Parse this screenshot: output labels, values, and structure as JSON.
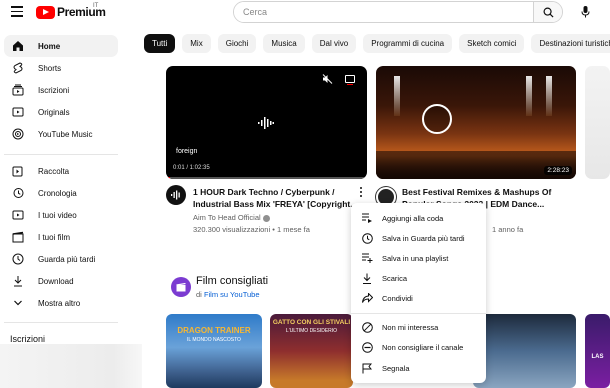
{
  "header": {
    "logo_text": "Premium",
    "country_code": "IT",
    "search_placeholder": "Cerca"
  },
  "sidebar": {
    "items": [
      {
        "label": "Home",
        "icon": "home-icon",
        "active": true
      },
      {
        "label": "Shorts",
        "icon": "shorts-icon"
      },
      {
        "label": "Iscrizioni",
        "icon": "subscriptions-icon"
      },
      {
        "label": "Originals",
        "icon": "originals-icon"
      },
      {
        "label": "YouTube Music",
        "icon": "music-icon"
      }
    ],
    "items2": [
      {
        "label": "Raccolta",
        "icon": "library-icon"
      },
      {
        "label": "Cronologia",
        "icon": "history-icon"
      },
      {
        "label": "I tuoi video",
        "icon": "your-videos-icon"
      },
      {
        "label": "I tuoi film",
        "icon": "your-movies-icon"
      },
      {
        "label": "Guarda più tardi",
        "icon": "watch-later-icon"
      },
      {
        "label": "Download",
        "icon": "download-icon"
      },
      {
        "label": "Mostra altro",
        "icon": "chevron-down-icon"
      }
    ],
    "subscriptions_title": "Iscrizioni"
  },
  "chips": [
    "Tutti",
    "Mix",
    "Giochi",
    "Musica",
    "Dal vivo",
    "Programmi di cucina",
    "Sketch comici",
    "Destinazioni turistiche"
  ],
  "videos": [
    {
      "title": "1 HOUR Dark Techno / Cyberpunk / Industrial Bass Mix 'FREYA' [Copyright...",
      "title_line1": "1 HOUR Dark Techno / Cyberpunk /",
      "title_line2": "Industrial Bass Mix 'FREYA' [Copyright...",
      "channel": "Aim To Head Official",
      "views": "320.300 visualizzazioni",
      "age": "1 mese fa",
      "overlay_label": "foreign",
      "time": "0:01 / 1:02:35",
      "progress": 0.02
    },
    {
      "title_line1": "Best Festival Remixes & Mashups Of",
      "title_line2": "Popular Songs 2023 | EDM Dance...",
      "age": "1 anno fa",
      "duration": "2:28:23"
    }
  ],
  "section": {
    "title": "Film consigliati",
    "sub_prefix": "di",
    "sub_link": "Film su YouTube"
  },
  "posters": [
    {
      "title": "DRAGON TRAINER",
      "subtitle": "IL MONDO NASCOSTO"
    },
    {
      "title": "GATTO CON GLI STIVALI",
      "subtitle": "L'ULTIMO DESIDERIO"
    },
    {
      "title": "",
      "subtitle": ""
    },
    {
      "title": "LAS",
      "subtitle": ""
    }
  ],
  "context_menu": {
    "items": [
      {
        "label": "Aggiungi alla coda",
        "icon": "add-to-queue-icon"
      },
      {
        "label": "Salva in Guarda più tardi",
        "icon": "clock-icon"
      },
      {
        "label": "Salva in una playlist",
        "icon": "playlist-add-icon"
      },
      {
        "label": "Scarica",
        "icon": "download-icon"
      },
      {
        "label": "Condividi",
        "icon": "share-icon"
      },
      {
        "label": "Non mi interessa",
        "icon": "not-interested-icon"
      },
      {
        "label": "Non consigliare il canale",
        "icon": "block-channel-icon"
      },
      {
        "label": "Segnala",
        "icon": "flag-icon"
      }
    ]
  }
}
